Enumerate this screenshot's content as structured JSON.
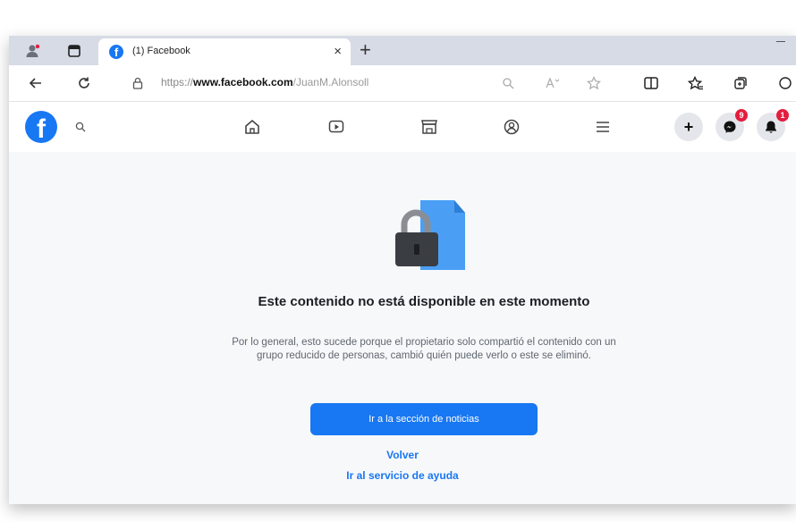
{
  "browser": {
    "tab_title": "(1) Facebook",
    "tab_close": "×",
    "new_tab": "+",
    "url_scheme": "https://",
    "url_domain": "www.facebook.com",
    "url_path": "/JuanM.Alonsoll"
  },
  "colors": {
    "facebook_blue": "#1877f2",
    "badge_red": "#e41e3f"
  },
  "fb_header": {
    "logo_letter": "f",
    "create_label": "+",
    "messenger_badge": "9",
    "notifications_badge": "1"
  },
  "content": {
    "heading": "Este contenido no está disponible en este momento",
    "description": "Por lo general, esto sucede porque el propietario solo compartió el contenido con un grupo reducido de personas, cambió quién puede verlo o este se eliminó.",
    "primary_button": "Ir a la sección de noticias",
    "back_link": "Volver",
    "help_link": "Ir al servicio de ayuda"
  }
}
